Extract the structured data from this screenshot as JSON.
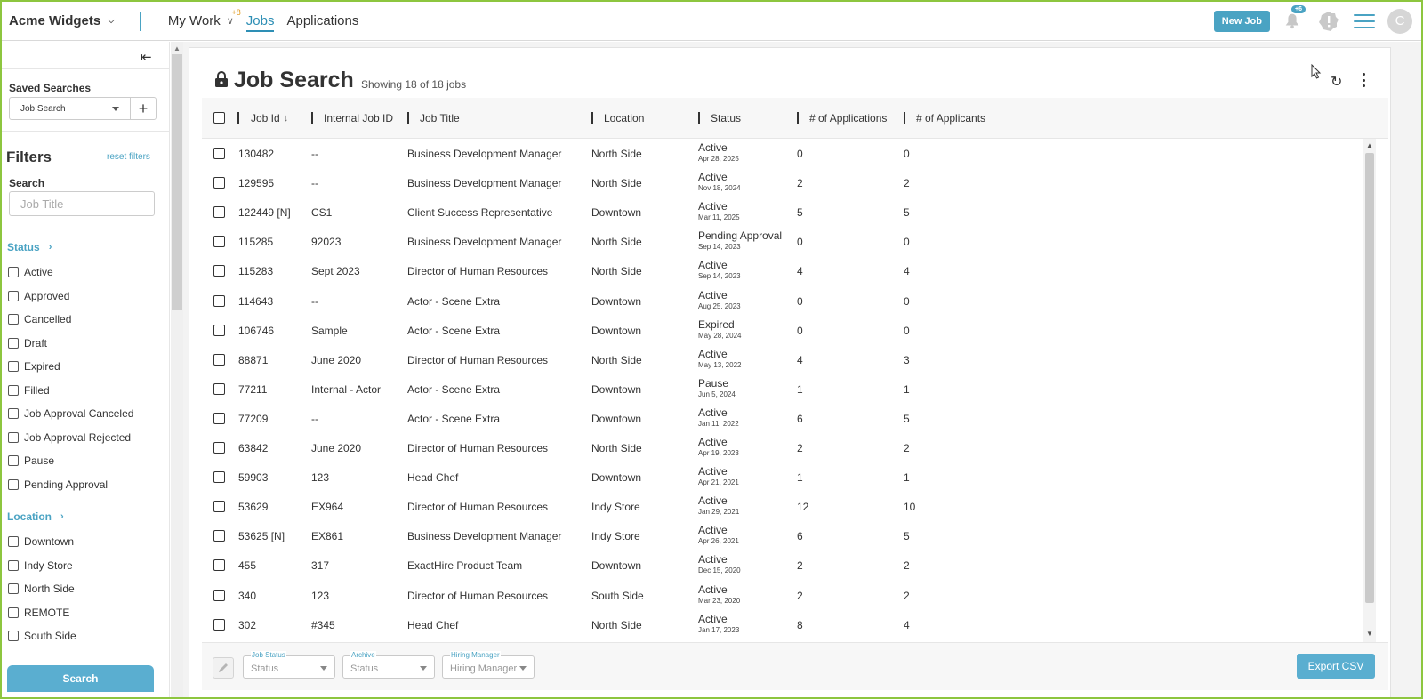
{
  "header": {
    "company": "Acme Widgets",
    "nav": {
      "my_work": "My Work",
      "my_work_badge": "+8",
      "jobs": "Jobs",
      "applications": "Applications"
    },
    "new_job": "New Job",
    "notif_count": "+6",
    "avatar_initial": "C",
    "accent_color": "#4aa3c3"
  },
  "sidebar": {
    "saved_searches_label": "Saved Searches",
    "saved_search_value": "Job Search",
    "add_icon": "+",
    "filters_title": "Filters",
    "reset_filters": "reset filters",
    "search_label": "Search",
    "search_placeholder": "Job Title",
    "status_heading": "Status",
    "status_options": [
      "Active",
      "Approved",
      "Cancelled",
      "Draft",
      "Expired",
      "Filled",
      "Job Approval Canceled",
      "Job Approval Rejected",
      "Pause",
      "Pending Approval"
    ],
    "location_heading": "Location",
    "location_options": [
      "Downtown",
      "Indy Store",
      "North Side",
      "REMOTE",
      "South Side"
    ],
    "search_button": "Search"
  },
  "main": {
    "title": "Job Search",
    "showing": "Showing 18 of 18 jobs",
    "columns": [
      "Job Id",
      "Internal Job ID",
      "Job Title",
      "Location",
      "Status",
      "# of Applications",
      "# of Applicants"
    ],
    "rows": [
      {
        "id": "130482",
        "internal": "--",
        "title": "Business Development Manager",
        "location": "North Side",
        "status": "Active",
        "date": "Apr 28, 2025",
        "apps": "0",
        "applicants": "0"
      },
      {
        "id": "129595",
        "internal": "--",
        "title": "Business Development Manager",
        "location": "North Side",
        "status": "Active",
        "date": "Nov 18, 2024",
        "apps": "2",
        "applicants": "2"
      },
      {
        "id": "122449 [N]",
        "internal": "CS1",
        "title": "Client Success Representative",
        "location": "Downtown",
        "status": "Active",
        "date": "Mar 11, 2025",
        "apps": "5",
        "applicants": "5"
      },
      {
        "id": "115285",
        "internal": "92023",
        "title": "Business Development Manager",
        "location": "North Side",
        "status": "Pending Approval",
        "date": "Sep 14, 2023",
        "apps": "0",
        "applicants": "0"
      },
      {
        "id": "115283",
        "internal": "Sept 2023",
        "title": "Director of Human Resources",
        "location": "North Side",
        "status": "Active",
        "date": "Sep 14, 2023",
        "apps": "4",
        "applicants": "4"
      },
      {
        "id": "114643",
        "internal": "--",
        "title": "Actor - Scene Extra",
        "location": "Downtown",
        "status": "Active",
        "date": "Aug 25, 2023",
        "apps": "0",
        "applicants": "0"
      },
      {
        "id": "106746",
        "internal": "Sample",
        "title": "Actor - Scene Extra",
        "location": "Downtown",
        "status": "Expired",
        "date": "May 28, 2024",
        "apps": "0",
        "applicants": "0"
      },
      {
        "id": "88871",
        "internal": "June 2020",
        "title": "Director of Human Resources",
        "location": "North Side",
        "status": "Active",
        "date": "May 13, 2022",
        "apps": "4",
        "applicants": "3"
      },
      {
        "id": "77211",
        "internal": "Internal - Actor",
        "title": "Actor - Scene Extra",
        "location": "Downtown",
        "status": "Pause",
        "date": "Jun 5, 2024",
        "apps": "1",
        "applicants": "1"
      },
      {
        "id": "77209",
        "internal": "--",
        "title": "Actor - Scene Extra",
        "location": "Downtown",
        "status": "Active",
        "date": "Jan 11, 2022",
        "apps": "6",
        "applicants": "5"
      },
      {
        "id": "63842",
        "internal": "June 2020",
        "title": "Director of Human Resources",
        "location": "North Side",
        "status": "Active",
        "date": "Apr 19, 2023",
        "apps": "2",
        "applicants": "2"
      },
      {
        "id": "59903",
        "internal": "123",
        "title": "Head Chef",
        "location": "Downtown",
        "status": "Active",
        "date": "Apr 21, 2021",
        "apps": "1",
        "applicants": "1"
      },
      {
        "id": "53629",
        "internal": "EX964",
        "title": "Director of Human Resources",
        "location": "Indy Store",
        "status": "Active",
        "date": "Jan 29, 2021",
        "apps": "12",
        "applicants": "10"
      },
      {
        "id": "53625 [N]",
        "internal": "EX861",
        "title": "Business Development Manager",
        "location": "Indy Store",
        "status": "Active",
        "date": "Apr 26, 2021",
        "apps": "6",
        "applicants": "5"
      },
      {
        "id": "455",
        "internal": "317",
        "title": "ExactHire Product Team",
        "location": "Downtown",
        "status": "Active",
        "date": "Dec 15, 2020",
        "apps": "2",
        "applicants": "2"
      },
      {
        "id": "340",
        "internal": "123",
        "title": "Director of Human Resources",
        "location": "South Side",
        "status": "Active",
        "date": "Mar 23, 2020",
        "apps": "2",
        "applicants": "2"
      },
      {
        "id": "302",
        "internal": "#345",
        "title": "Head Chef",
        "location": "North Side",
        "status": "Active",
        "date": "Jan 17, 2023",
        "apps": "8",
        "applicants": "4"
      }
    ],
    "footer": {
      "job_status_label": "Job Status",
      "job_status_value": "Status",
      "archive_label": "Archive",
      "archive_value": "Status",
      "hiring_manager_label": "Hiring Manager",
      "hiring_manager_value": "Hiring Manager",
      "export": "Export CSV"
    }
  }
}
